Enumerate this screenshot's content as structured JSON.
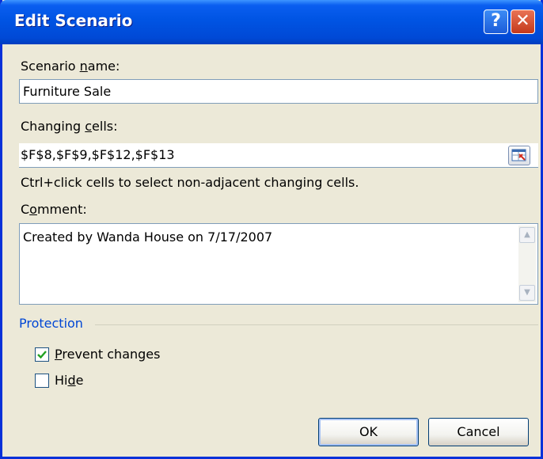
{
  "window": {
    "title": "Edit Scenario"
  },
  "titlebar": {
    "help_glyph": "?",
    "close_glyph": "✕"
  },
  "scenario_name": {
    "label_before": "Scenario ",
    "label_access": "n",
    "label_after": "ame:",
    "value": "Furniture Sale"
  },
  "changing_cells": {
    "label_before": "Changing ",
    "label_access": "c",
    "label_after": "ells:",
    "value": "$F$8,$F$9,$F$12,$F$13",
    "hint": "Ctrl+click cells to select non-adjacent changing cells."
  },
  "comment": {
    "label_before": "C",
    "label_access": "o",
    "label_after": "mment:",
    "value": "Created by Wanda House on 7/17/2007"
  },
  "protection": {
    "title": "Protection",
    "prevent_changes": {
      "access": "P",
      "rest": "revent changes",
      "checked": true
    },
    "hide": {
      "before": "Hi",
      "access": "d",
      "after": "e",
      "checked": false
    }
  },
  "buttons": {
    "ok": "OK",
    "cancel": "Cancel"
  }
}
